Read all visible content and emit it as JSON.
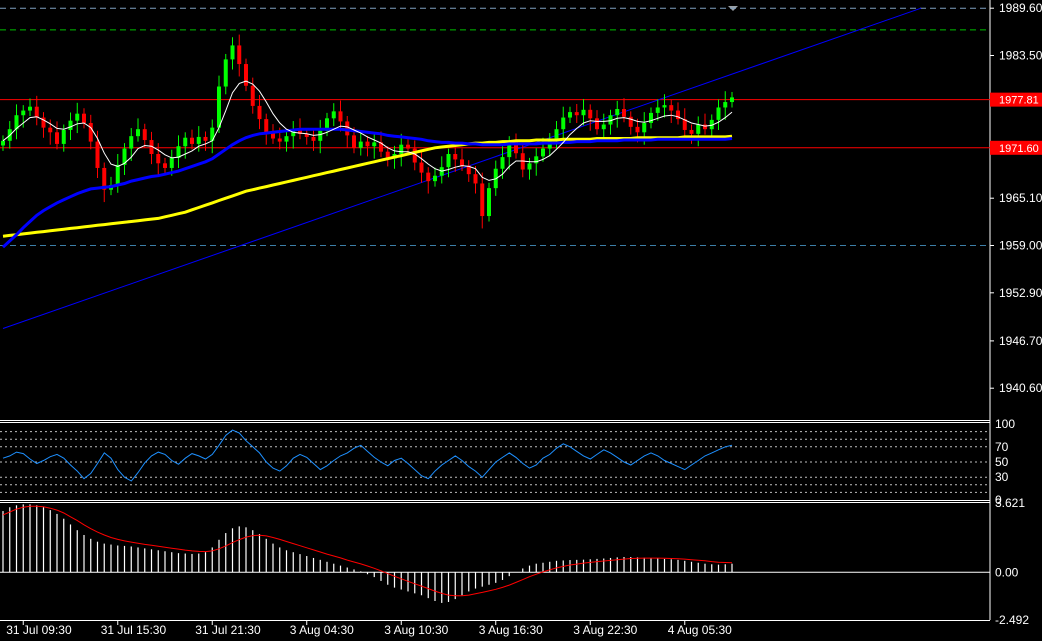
{
  "theme": {
    "background": "#000000",
    "axis_color": "#ffffff",
    "bull_candle": "#00ff00",
    "bear_candle": "#ff0000",
    "ma_fast_color": "#ffffff",
    "ma_mid_color": "#0000ff",
    "ma_slow_color": "#ffff00",
    "hline_color": "#ff0000",
    "trendline_color": "#0000ff",
    "level_dash_color_green": "#00c000",
    "level_dash_color_blue": "#3d7fa8",
    "rsi_color": "#1e90ff",
    "macd_hist_color": "#ffffff",
    "macd_signal_color": "#ff0000"
  },
  "chart_data": [
    {
      "type": "line",
      "panel": "price",
      "ylim": [
        1936.5,
        1990.4
      ],
      "y_ticks": [
        "1989.60",
        "1983.50",
        "1977.81",
        "1971.60",
        "1965.10",
        "1959.00",
        "1952.90",
        "1946.70",
        "1940.60"
      ],
      "x_ticks": [
        "31 Jul 09:30",
        "31 Jul 15:30",
        "31 Jul 21:30",
        "3 Aug 04:30",
        "3 Aug 10:30",
        "3 Aug 16:30",
        "3 Aug 22:30",
        "4 Aug 05:30"
      ],
      "price_tags": [
        {
          "label": "1977.81",
          "value": 1977.81,
          "color": "#ff0000"
        },
        {
          "label": "1971.60",
          "value": 1971.6,
          "color": "#ff0000"
        }
      ],
      "horizontal_lines": [
        {
          "value": 1977.81,
          "style": "solid",
          "color": "#ff0000"
        },
        {
          "value": 1971.6,
          "style": "solid",
          "color": "#ff0000"
        },
        {
          "value": 1986.8,
          "style": "dashed",
          "color": "#00c000"
        },
        {
          "value": 1959.0,
          "style": "dashed",
          "color": "#3d7fa8"
        },
        {
          "value": 1989.6,
          "style": "dashed",
          "color": "#7f9fbf"
        }
      ],
      "trendline": {
        "x_start": 0,
        "y_start": 1948.3,
        "x_end": 136,
        "y_end": 1989.6
      },
      "close": [
        1972.5,
        1974.0,
        1975.8,
        1976.4,
        1976.9,
        1975.5,
        1974.2,
        1973.6,
        1972.1,
        1973.9,
        1975.1,
        1976.0,
        1974.8,
        1972.4,
        1969.0,
        1966.2,
        1966.8,
        1969.4,
        1971.5,
        1973.1,
        1974.0,
        1972.6,
        1970.8,
        1969.6,
        1969.0,
        1970.3,
        1971.8,
        1972.9,
        1972.1,
        1973.0,
        1972.5,
        1974.2,
        1979.5,
        1983.0,
        1984.8,
        1982.4,
        1979.6,
        1977.0,
        1975.3,
        1973.6,
        1972.8,
        1972.4,
        1973.1,
        1974.0,
        1973.4,
        1973.0,
        1972.5,
        1973.8,
        1975.4,
        1976.3,
        1975.0,
        1973.2,
        1971.6,
        1972.4,
        1971.8,
        1972.3,
        1971.1,
        1970.2,
        1970.8,
        1972.0,
        1971.5,
        1969.7,
        1968.4,
        1967.3,
        1968.0,
        1969.1,
        1970.8,
        1970.1,
        1969.3,
        1968.2,
        1967.0,
        1962.8,
        1966.4,
        1968.9,
        1970.4,
        1972.4,
        1970.9,
        1968.8,
        1969.6,
        1970.5,
        1971.5,
        1972.8,
        1974.0,
        1975.5,
        1976.2,
        1975.8,
        1976.5,
        1975.4,
        1974.0,
        1974.6,
        1975.8,
        1976.6,
        1975.6,
        1974.3,
        1973.6,
        1974.8,
        1976.1,
        1976.8,
        1977.1,
        1976.4,
        1975.3,
        1973.9,
        1973.4,
        1974.6,
        1974.0,
        1975.2,
        1976.8,
        1977.5,
        1978.1
      ],
      "ma_fast": [
        1972.5,
        1973.2,
        1974.1,
        1974.8,
        1975.5,
        1975.6,
        1975.2,
        1974.7,
        1974.1,
        1974.0,
        1974.3,
        1974.7,
        1974.8,
        1974.2,
        1972.8,
        1970.9,
        1969.5,
        1969.2,
        1969.6,
        1970.4,
        1971.5,
        1971.9,
        1971.8,
        1971.3,
        1970.7,
        1970.3,
        1970.4,
        1970.8,
        1971.2,
        1971.8,
        1972.1,
        1972.5,
        1974.2,
        1976.4,
        1978.7,
        1979.9,
        1980.2,
        1979.8,
        1978.9,
        1977.5,
        1976.0,
        1974.8,
        1974.0,
        1973.6,
        1973.5,
        1973.4,
        1973.2,
        1973.3,
        1973.6,
        1974.0,
        1974.4,
        1974.3,
        1973.9,
        1973.5,
        1973.0,
        1972.6,
        1972.2,
        1971.6,
        1971.2,
        1971.1,
        1971.1,
        1970.8,
        1970.2,
        1969.5,
        1968.9,
        1968.6,
        1968.8,
        1969.1,
        1969.3,
        1969.2,
        1968.9,
        1967.8,
        1967.4,
        1967.6,
        1968.2,
        1969.2,
        1969.9,
        1969.9,
        1969.8,
        1969.8,
        1970.1,
        1970.6,
        1971.4,
        1972.3,
        1973.3,
        1974.1,
        1974.8,
        1975.1,
        1975.0,
        1975.0,
        1975.1,
        1975.4,
        1975.5,
        1975.3,
        1975.0,
        1974.9,
        1975.1,
        1975.4,
        1975.7,
        1975.8,
        1975.6,
        1975.2,
        1974.8,
        1974.6,
        1974.4,
        1974.5,
        1974.9,
        1975.5,
        1976.2
      ],
      "ma_mid": [
        1958.8,
        1959.6,
        1960.4,
        1961.3,
        1962.1,
        1962.9,
        1963.5,
        1964.0,
        1964.5,
        1964.9,
        1965.3,
        1965.7,
        1966.0,
        1966.3,
        1966.4,
        1966.5,
        1966.6,
        1966.8,
        1967.0,
        1967.3,
        1967.5,
        1967.7,
        1967.9,
        1968.0,
        1968.2,
        1968.4,
        1968.6,
        1968.9,
        1969.2,
        1969.5,
        1969.8,
        1970.2,
        1970.8,
        1971.4,
        1972.0,
        1972.5,
        1972.9,
        1973.2,
        1973.4,
        1973.5,
        1973.6,
        1973.7,
        1973.8,
        1973.9,
        1974.0,
        1974.0,
        1974.0,
        1974.0,
        1974.0,
        1974.0,
        1974.0,
        1973.9,
        1973.8,
        1973.7,
        1973.6,
        1973.5,
        1973.4,
        1973.2,
        1973.1,
        1973.0,
        1972.9,
        1972.8,
        1972.7,
        1972.5,
        1972.4,
        1972.3,
        1972.3,
        1972.2,
        1972.2,
        1972.1,
        1972.1,
        1972.0,
        1972.0,
        1972.0,
        1972.0,
        1972.1,
        1972.1,
        1972.1,
        1972.1,
        1972.1,
        1972.2,
        1972.2,
        1972.2,
        1972.3,
        1972.3,
        1972.4,
        1972.4,
        1972.4,
        1972.5,
        1972.5,
        1972.5,
        1972.5,
        1972.6,
        1972.6,
        1972.6,
        1972.6,
        1972.6,
        1972.7,
        1972.7,
        1972.7,
        1972.7,
        1972.7,
        1972.7,
        1972.7,
        1972.7,
        1972.7,
        1972.7,
        1972.7,
        1972.8
      ],
      "ma_slow": [
        1960.2,
        1960.3,
        1960.4,
        1960.5,
        1960.6,
        1960.7,
        1960.8,
        1960.9,
        1961.0,
        1961.1,
        1961.2,
        1961.3,
        1961.4,
        1961.5,
        1961.6,
        1961.7,
        1961.8,
        1961.9,
        1962.0,
        1962.1,
        1962.2,
        1962.3,
        1962.4,
        1962.5,
        1962.7,
        1962.9,
        1963.1,
        1963.3,
        1963.6,
        1963.9,
        1964.2,
        1964.5,
        1964.8,
        1965.1,
        1965.4,
        1965.7,
        1966.0,
        1966.2,
        1966.4,
        1966.6,
        1966.8,
        1967.0,
        1967.2,
        1967.4,
        1967.6,
        1967.8,
        1968.0,
        1968.2,
        1968.4,
        1968.6,
        1968.8,
        1969.0,
        1969.2,
        1969.4,
        1969.6,
        1969.8,
        1970.0,
        1970.2,
        1970.4,
        1970.6,
        1970.8,
        1971.0,
        1971.2,
        1971.4,
        1971.6,
        1971.7,
        1971.8,
        1971.9,
        1972.0,
        1972.1,
        1972.2,
        1972.2,
        1972.3,
        1972.3,
        1972.4,
        1972.4,
        1972.5,
        1972.5,
        1972.5,
        1972.6,
        1972.6,
        1972.6,
        1972.6,
        1972.7,
        1972.7,
        1972.7,
        1972.7,
        1972.7,
        1972.8,
        1972.8,
        1972.8,
        1972.8,
        1972.8,
        1972.8,
        1972.9,
        1972.9,
        1972.9,
        1972.9,
        1972.9,
        1972.9,
        1972.9,
        1973.0,
        1973.0,
        1973.0,
        1973.0,
        1973.0,
        1973.0,
        1973.0,
        1973.1
      ]
    },
    {
      "type": "line",
      "panel": "rsi",
      "ylim": [
        0,
        100
      ],
      "y_ticks": [
        "100",
        "70",
        "50",
        "30",
        "0"
      ],
      "y_tick_values": [
        100,
        70,
        50,
        30,
        0
      ],
      "levels": [
        90,
        80,
        70,
        50,
        30,
        20,
        10
      ],
      "values": [
        55,
        58,
        63,
        61,
        54,
        48,
        52,
        57,
        60,
        55,
        46,
        38,
        28,
        35,
        48,
        62,
        55,
        40,
        30,
        25,
        36,
        49,
        58,
        63,
        60,
        52,
        47,
        55,
        61,
        58,
        54,
        60,
        72,
        85,
        92,
        88,
        78,
        70,
        62,
        50,
        42,
        38,
        45,
        55,
        60,
        56,
        48,
        40,
        45,
        52,
        58,
        62,
        68,
        72,
        64,
        56,
        50,
        45,
        52,
        55,
        48,
        40,
        32,
        28,
        38,
        46,
        52,
        58,
        52,
        44,
        38,
        30,
        40,
        50,
        56,
        62,
        56,
        48,
        42,
        46,
        55,
        60,
        68,
        74,
        70,
        64,
        58,
        54,
        60,
        66,
        62,
        56,
        50,
        46,
        52,
        58,
        62,
        58,
        52,
        48,
        44,
        40,
        46,
        52,
        58,
        62,
        66,
        70,
        72
      ]
    },
    {
      "type": "bar",
      "panel": "macd",
      "ylim": [
        -2.492,
        3.621
      ],
      "y_ticks": [
        "3.621",
        "0.00",
        "-2.492"
      ],
      "y_tick_values": [
        3.621,
        0.0,
        -2.492
      ],
      "values": [
        3.2,
        3.4,
        3.5,
        3.55,
        3.55,
        3.5,
        3.4,
        3.25,
        3.05,
        2.8,
        2.5,
        2.2,
        1.95,
        1.75,
        1.6,
        1.5,
        1.45,
        1.4,
        1.38,
        1.35,
        1.3,
        1.25,
        1.2,
        1.15,
        1.1,
        1.05,
        1.0,
        0.98,
        0.96,
        0.98,
        1.05,
        1.3,
        1.7,
        2.05,
        2.3,
        2.4,
        2.35,
        2.2,
        2.0,
        1.75,
        1.5,
        1.3,
        1.15,
        1.05,
        0.95,
        0.85,
        0.75,
        0.65,
        0.55,
        0.45,
        0.35,
        0.25,
        0.15,
        0.05,
        -0.1,
        -0.25,
        -0.45,
        -0.65,
        -0.8,
        -0.9,
        -1.0,
        -1.1,
        -1.2,
        -1.35,
        -1.5,
        -1.6,
        -1.55,
        -1.4,
        -1.2,
        -1.0,
        -0.85,
        -0.75,
        -0.65,
        -0.55,
        -0.4,
        -0.2,
        0.0,
        0.2,
        0.35,
        0.45,
        0.5,
        0.55,
        0.6,
        0.62,
        0.64,
        0.65,
        0.66,
        0.68,
        0.7,
        0.72,
        0.75,
        0.78,
        0.8,
        0.8,
        0.78,
        0.76,
        0.74,
        0.72,
        0.7,
        0.68,
        0.65,
        0.6,
        0.55,
        0.5,
        0.45,
        0.42,
        0.4,
        0.42,
        0.45
      ],
      "signal": [
        3.0,
        3.15,
        3.3,
        3.4,
        3.45,
        3.45,
        3.42,
        3.35,
        3.25,
        3.1,
        2.9,
        2.7,
        2.48,
        2.28,
        2.1,
        1.95,
        1.82,
        1.72,
        1.64,
        1.58,
        1.52,
        1.46,
        1.41,
        1.36,
        1.31,
        1.26,
        1.21,
        1.16,
        1.12,
        1.09,
        1.08,
        1.12,
        1.23,
        1.38,
        1.55,
        1.71,
        1.84,
        1.92,
        1.94,
        1.9,
        1.82,
        1.72,
        1.61,
        1.5,
        1.39,
        1.28,
        1.17,
        1.06,
        0.95,
        0.85,
        0.75,
        0.64,
        0.54,
        0.44,
        0.33,
        0.21,
        0.08,
        -0.07,
        -0.21,
        -0.34,
        -0.47,
        -0.6,
        -0.72,
        -0.85,
        -0.98,
        -1.1,
        -1.19,
        -1.23,
        -1.23,
        -1.19,
        -1.12,
        -1.05,
        -0.97,
        -0.89,
        -0.79,
        -0.67,
        -0.53,
        -0.38,
        -0.23,
        -0.1,
        0.02,
        0.13,
        0.23,
        0.31,
        0.38,
        0.43,
        0.48,
        0.52,
        0.56,
        0.59,
        0.62,
        0.66,
        0.69,
        0.72,
        0.73,
        0.74,
        0.74,
        0.74,
        0.73,
        0.72,
        0.71,
        0.69,
        0.66,
        0.63,
        0.6,
        0.56,
        0.53,
        0.51,
        0.5
      ]
    }
  ]
}
